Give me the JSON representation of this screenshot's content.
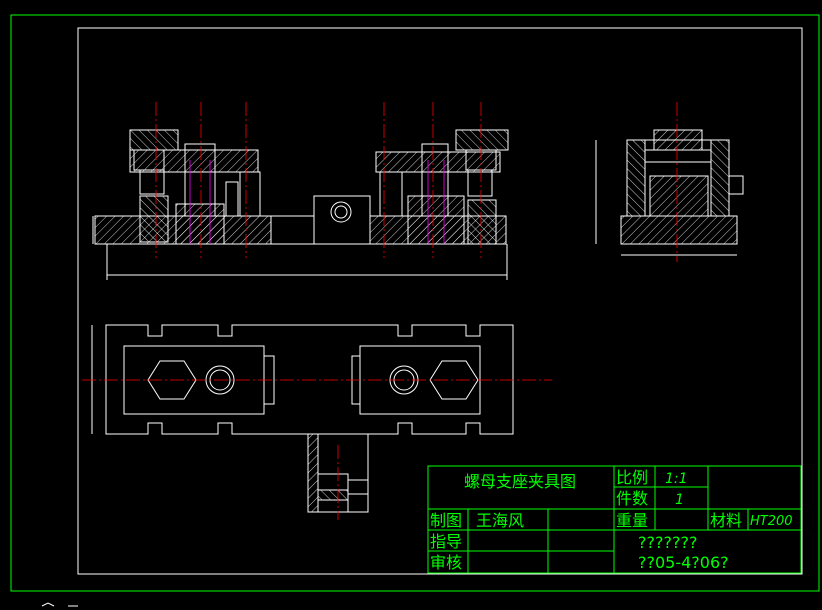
{
  "colors": {
    "background": "#000000",
    "frame": "#00ff00",
    "outline": "#ffffff",
    "centerline": "#ff0000",
    "hidden": "#ff00ff",
    "hatch": "#ffffff"
  },
  "title_block": {
    "drawing_title": "螺母支座夹具图",
    "scale_label": "比例",
    "scale_value": "1:1",
    "quantity_label": "件数",
    "quantity_value": "1",
    "weight_label": "重量",
    "material_label": "材料",
    "material_value": "HT200",
    "drawn_by_label": "制图",
    "drawn_by_name": "王海风",
    "guide_label": "指导",
    "review_label": "审核",
    "school_line": "???????",
    "code_line": "??05-4?06?"
  },
  "icons": {
    "ucs": "ucs-axis-icon"
  }
}
